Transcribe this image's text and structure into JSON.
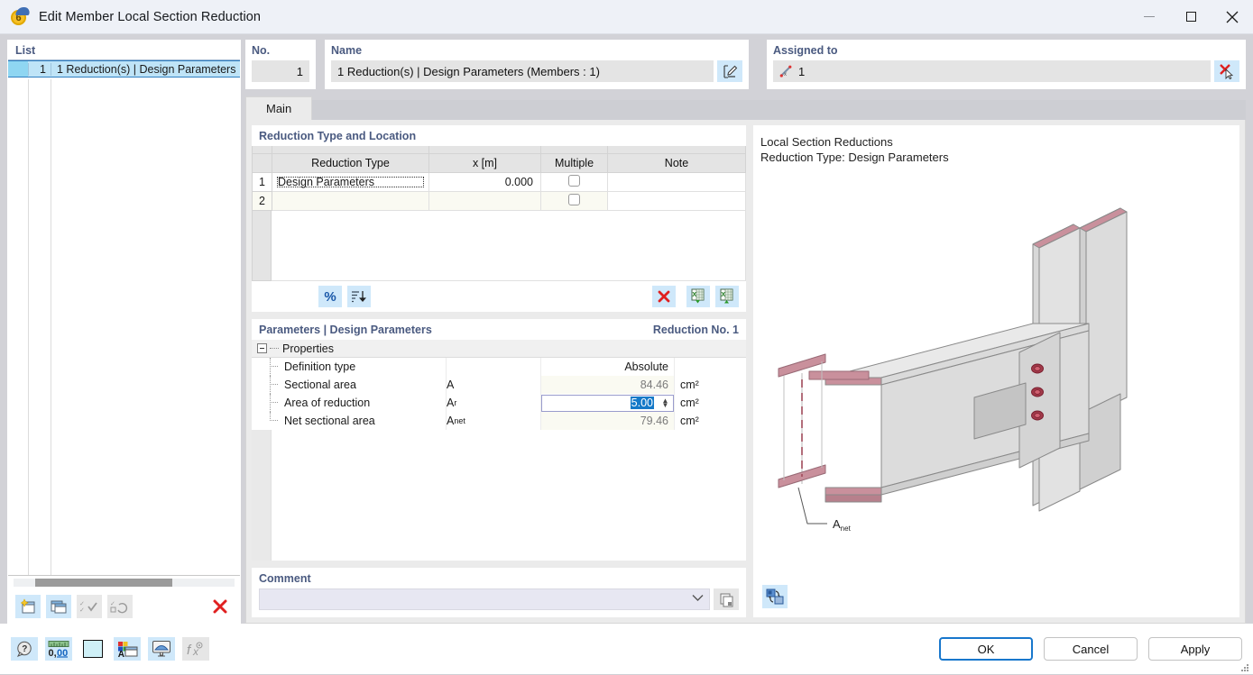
{
  "window": {
    "title": "Edit Member Local Section Reduction",
    "icon": "app-logo-6-icon",
    "minimize": "—",
    "maximize": "□",
    "close": "✕"
  },
  "list": {
    "title": "List",
    "rows": [
      {
        "num": "1",
        "label": "1 Reduction(s) | Design Parameters"
      }
    ],
    "toolbar": [
      {
        "name": "new-item-button",
        "enabled": true
      },
      {
        "name": "copy-item-button",
        "enabled": true
      },
      {
        "name": "select-all-button",
        "enabled": false
      },
      {
        "name": "invert-selection-button",
        "enabled": false
      },
      {
        "name": "delete-item-button",
        "enabled": true
      }
    ]
  },
  "header": {
    "no_label": "No.",
    "no_value": "1",
    "name_label": "Name",
    "name_value": "1 Reduction(s) | Design Parameters (Members : 1)",
    "name_edit_icon": "edit-name-icon",
    "assigned_label": "Assigned to",
    "assigned_value": "1",
    "assigned_member_icon": "member-icon",
    "assigned_pick_icon": "pick-in-graphic-icon"
  },
  "tabs": [
    {
      "label": "Main",
      "active": true
    }
  ],
  "reduction_group": {
    "title": "Reduction Type and Location",
    "columns": [
      "",
      "Reduction Type",
      "x [m]",
      "Multiple",
      "Note"
    ],
    "rows": [
      {
        "idx": "1",
        "type": "Design Parameters",
        "x": "0.000",
        "multiple": false,
        "note": ""
      },
      {
        "idx": "2",
        "type": "",
        "x": "",
        "multiple": false,
        "note": ""
      }
    ],
    "toolbar": [
      {
        "name": "percent-button",
        "label": "%"
      },
      {
        "name": "sort-button",
        "label": "sort-icon"
      },
      {
        "name": "delete-row-button",
        "label": "delete-icon"
      },
      {
        "name": "import-excel-button",
        "label": "excel-import-icon"
      },
      {
        "name": "export-excel-button",
        "label": "excel-export-icon"
      }
    ]
  },
  "parameters_group": {
    "title": "Parameters | Design Parameters",
    "reduction_no": "Reduction No. 1",
    "tree_root": "Properties",
    "rows": [
      {
        "label": "Definition type",
        "symbol": "",
        "value": "Absolute",
        "unit": "",
        "editable": false,
        "style": "plain"
      },
      {
        "label": "Sectional area",
        "symbol": "A",
        "value": "84.46",
        "unit": "cm²",
        "editable": false,
        "style": "readonly"
      },
      {
        "label": "Area of reduction",
        "symbol": "Ar",
        "value": "5.00",
        "unit": "cm²",
        "editable": true,
        "style": "spin"
      },
      {
        "label": "Net sectional area",
        "symbol": "Anet",
        "value": "79.46",
        "unit": "cm²",
        "editable": false,
        "style": "readonly"
      }
    ]
  },
  "comment": {
    "title": "Comment",
    "value": "",
    "placeholder": "",
    "chevron": "⌄",
    "copy_icon": "copy-comment-icon"
  },
  "preview": {
    "line1": "Local Section Reductions",
    "line2": "Reduction Type: Design Parameters",
    "annotation": "Anet",
    "rotate_icon": "rotate-view-icon"
  },
  "bottom_tools": [
    {
      "name": "help-button",
      "enabled": true
    },
    {
      "name": "units-button",
      "enabled": true
    },
    {
      "name": "color-swatch-button",
      "enabled": true
    },
    {
      "name": "display-properties-button",
      "enabled": true
    },
    {
      "name": "render-view-button",
      "enabled": true
    },
    {
      "name": "formula-button",
      "enabled": false
    }
  ],
  "buttons": {
    "ok": "OK",
    "cancel": "Cancel",
    "apply": "Apply"
  },
  "colors": {
    "accent": "#4a5a80",
    "selection": "#1579c8",
    "list_highlight": "#bfe4f7",
    "toolbtn": "#cfe8fa",
    "delete_red": "#e02020"
  }
}
